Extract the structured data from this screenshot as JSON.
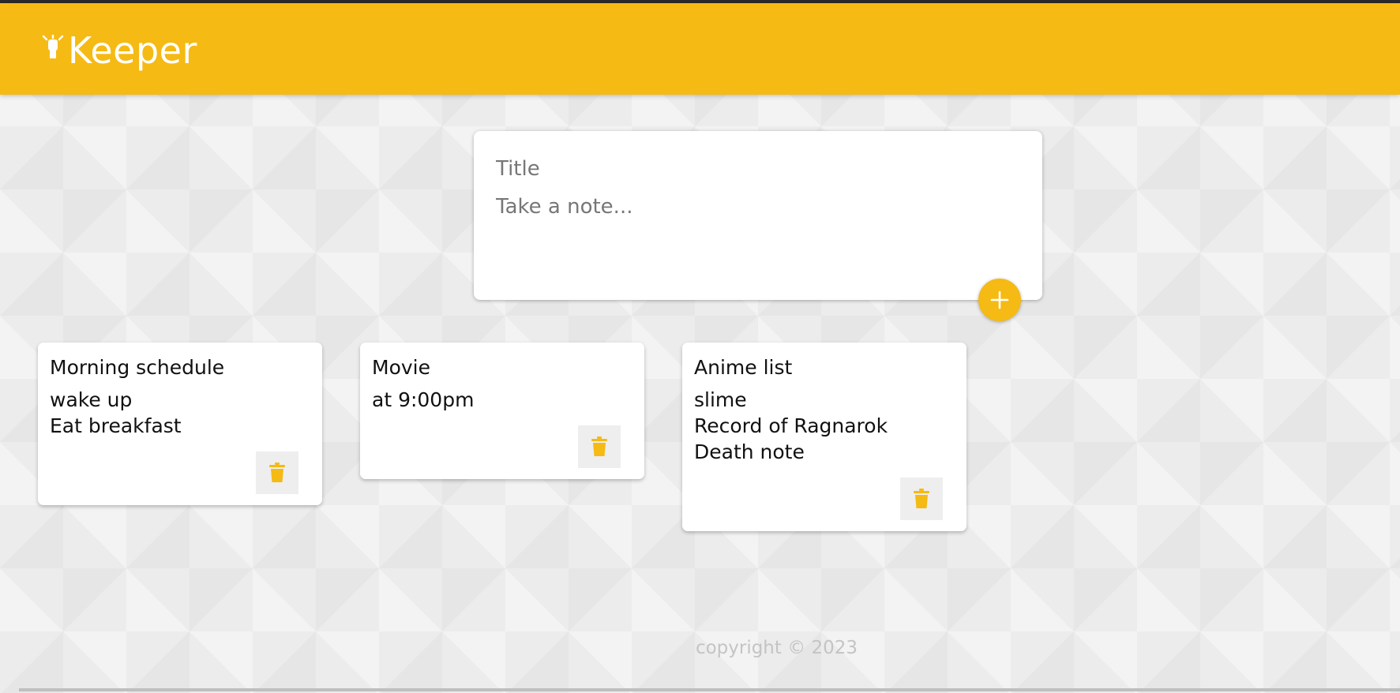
{
  "app": {
    "title": "Keeper",
    "brand_icon": "lightbulb-icon"
  },
  "colors": {
    "accent": "#f5ba13",
    "background": "#ececec",
    "card": "#ffffff"
  },
  "create_note": {
    "title_placeholder": "Title",
    "content_placeholder": "Take a note...",
    "add_icon": "plus-icon"
  },
  "notes": [
    {
      "title": "Morning schedule",
      "lines": [
        "wake up",
        "Eat breakfast"
      ],
      "delete_icon": "trash-icon"
    },
    {
      "title": "Movie",
      "lines": [
        "at 9:00pm"
      ],
      "delete_icon": "trash-icon"
    },
    {
      "title": "Anime list",
      "lines": [
        "slime",
        "Record of Ragnarok",
        "Death note"
      ],
      "delete_icon": "trash-icon"
    }
  ],
  "footer": {
    "copyright": "copyright © 2023"
  }
}
